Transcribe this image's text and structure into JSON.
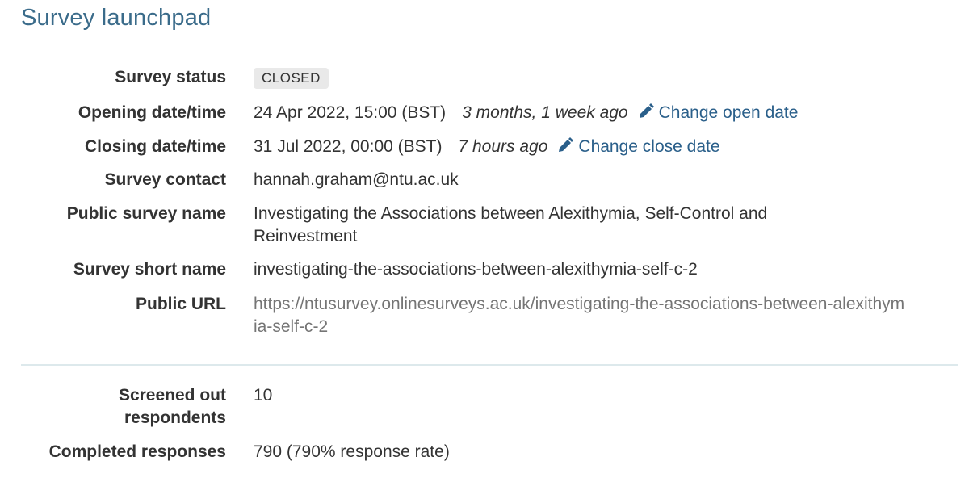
{
  "page": {
    "title": "Survey launchpad"
  },
  "details": {
    "status": {
      "label": "Survey status",
      "value": "CLOSED"
    },
    "opening": {
      "label": "Opening date/time",
      "value": "24 Apr 2022, 15:00 (BST)",
      "relative": "3 months, 1 week ago",
      "change_label": "Change open date",
      "icon": "pencil-icon"
    },
    "closing": {
      "label": "Closing date/time",
      "value": "31 Jul 2022, 00:00 (BST)",
      "relative": "7 hours ago",
      "change_label": "Change close date",
      "icon": "pencil-icon"
    },
    "contact": {
      "label": "Survey contact",
      "value": "hannah.graham@ntu.ac.uk"
    },
    "public_name": {
      "label": "Public survey name",
      "value": "Investigating the Associations between Alexithymia, Self-Control and Reinvestment"
    },
    "short_name": {
      "label": "Survey short name",
      "value": "investigating-the-associations-between-alexithymia-self-c-2"
    },
    "public_url": {
      "label": "Public URL",
      "value": "https://ntusurvey.onlinesurveys.ac.uk/investigating-the-associations-between-alexithymia-self-c-2"
    }
  },
  "stats": {
    "screened_out": {
      "label": "Screened out respondents",
      "value": "10"
    },
    "completed": {
      "label": "Completed responses",
      "value": "790 (790% response rate)"
    }
  },
  "colors": {
    "title": "#3a6b8a",
    "link": "#2a5f8a",
    "url": "#757575",
    "badge_bg": "#e9e9e9",
    "divider": "#dde9ec"
  }
}
